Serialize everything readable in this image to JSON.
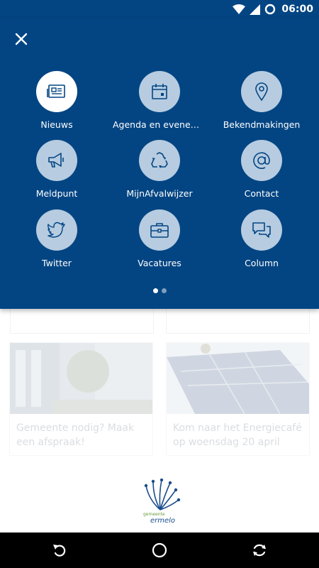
{
  "status_bar": {
    "time": "06:00",
    "icons": [
      "wifi-icon",
      "signal-icon",
      "circle-icon"
    ]
  },
  "menu": {
    "close_icon": "close-icon",
    "page_indicator": {
      "count": 2,
      "current": 1
    },
    "items": [
      {
        "label": "Nieuws",
        "icon": "newspaper-icon",
        "active": true
      },
      {
        "label": "Agenda en evenemen...",
        "icon": "calendar-icon",
        "active": false
      },
      {
        "label": "Bekendmakingen",
        "icon": "map-pin-icon",
        "active": false
      },
      {
        "label": "Meldpunt",
        "icon": "megaphone-icon",
        "active": false
      },
      {
        "label": "MijnAfvalwijzer",
        "icon": "recycle-icon",
        "active": false
      },
      {
        "label": "Contact",
        "icon": "at-icon",
        "active": false
      },
      {
        "label": "Twitter",
        "icon": "twitter-icon",
        "active": false
      },
      {
        "label": "Vacatures",
        "icon": "briefcase-icon",
        "active": false
      },
      {
        "label": "Column",
        "icon": "chat-bubbles-icon",
        "active": false
      }
    ]
  },
  "news": {
    "cards": [
      {
        "title": "Gemeente nodig? Maak een afspraak!"
      },
      {
        "title": "Kom naar het Energiecafé op woensdag 20 april"
      }
    ]
  },
  "logo": {
    "line1": "gemeente",
    "line2": "ermelo"
  },
  "nav_bar": {
    "icons": [
      "back-icon",
      "home-icon",
      "recents-icon"
    ]
  },
  "colors": {
    "primary": "#034583",
    "tile": "#b7cce0",
    "tile_active": "#ffffff",
    "icon": "#034583"
  }
}
